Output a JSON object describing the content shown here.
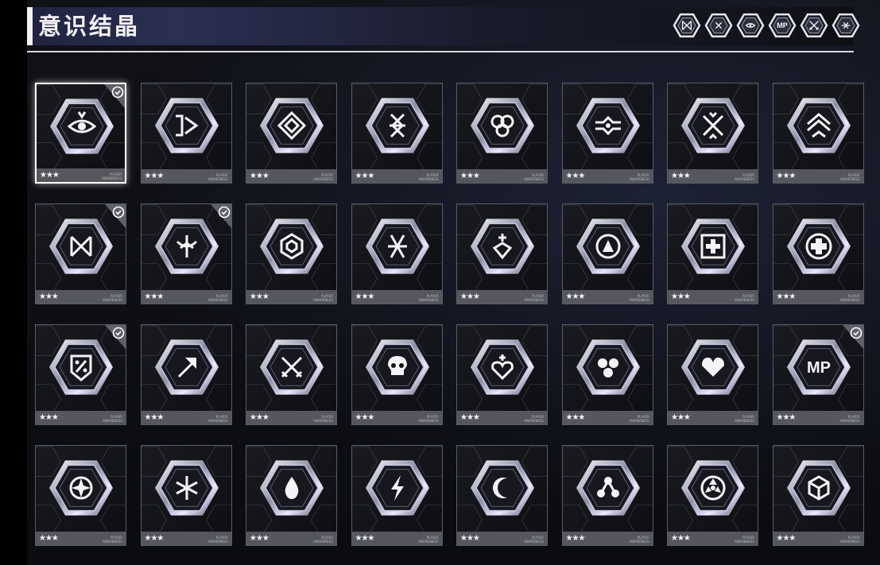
{
  "title": "意识结晶",
  "colors": {
    "accent": "#2b2f52",
    "card_border": "#5a5c66",
    "foot": "#55565e",
    "check_bg": "#5f606a"
  },
  "filters": [
    {
      "icon": "crossed-arrows-icon",
      "label": ""
    },
    {
      "icon": "x-diamond-icon",
      "label": ""
    },
    {
      "icon": "eye-diamond-icon",
      "label": ""
    },
    {
      "icon": "mp-icon",
      "label": "MP"
    },
    {
      "icon": "crossed-swords-icon",
      "label": ""
    },
    {
      "icon": "wing-icon",
      "label": ""
    }
  ],
  "cards": [
    {
      "icon": "eye-target-icon",
      "stars": "★★★",
      "caption1": "PLAYER",
      "caption2": "AWARENESS",
      "equipped": true,
      "selected": true
    },
    {
      "icon": "bracket-arrow-icon",
      "stars": "★★★",
      "caption1": "PLAYER",
      "caption2": "AWARENESS",
      "equipped": false,
      "selected": false
    },
    {
      "icon": "diamond-knot-icon",
      "stars": "★★★",
      "caption1": "PLAYER",
      "caption2": "AWARENESS",
      "equipped": false,
      "selected": false
    },
    {
      "icon": "chevron-lattice-icon",
      "stars": "★★★",
      "caption1": "PLAYER",
      "caption2": "AWARENESS",
      "equipped": false,
      "selected": false
    },
    {
      "icon": "triple-hex-icon",
      "stars": "★★★",
      "caption1": "PLAYER",
      "caption2": "AWARENESS",
      "equipped": false,
      "selected": false
    },
    {
      "icon": "circuit-eye-icon",
      "stars": "★★★",
      "caption1": "PLAYER",
      "caption2": "AWARENESS",
      "equipped": false,
      "selected": false
    },
    {
      "icon": "x-chevrons-icon",
      "stars": "★★★",
      "caption1": "PLAYER",
      "caption2": "AWARENESS",
      "equipped": false,
      "selected": false
    },
    {
      "icon": "layered-chevron-icon",
      "stars": "★★★",
      "caption1": "PLAYER",
      "caption2": "AWARENESS",
      "equipped": false,
      "selected": false
    },
    {
      "icon": "crossed-arrows-icon",
      "stars": "★★★",
      "caption1": "PLAYER",
      "caption2": "AWARENESS",
      "equipped": true,
      "selected": false
    },
    {
      "icon": "tree-sigil-icon",
      "stars": "★★★",
      "caption1": "PLAYER",
      "caption2": "AWARENESS",
      "equipped": true,
      "selected": false
    },
    {
      "icon": "hex-shield-icon",
      "stars": "★★★",
      "caption1": "PLAYER",
      "caption2": "AWARENESS",
      "equipped": false,
      "selected": false
    },
    {
      "icon": "star-cross-icon",
      "stars": "★★★",
      "caption1": "PLAYER",
      "caption2": "AWARENESS",
      "equipped": false,
      "selected": false
    },
    {
      "icon": "plus-gem-icon",
      "stars": "★★★",
      "caption1": "PLAYER",
      "caption2": "AWARENESS",
      "equipped": false,
      "selected": false
    },
    {
      "icon": "circle-a-icon",
      "stars": "★★★",
      "caption1": "PLAYER",
      "caption2": "AWARENESS",
      "equipped": false,
      "selected": false
    },
    {
      "icon": "medical-box-icon",
      "stars": "★★★",
      "caption1": "PLAYER",
      "caption2": "AWARENESS",
      "equipped": false,
      "selected": false
    },
    {
      "icon": "medical-cross-icon",
      "stars": "★★★",
      "caption1": "PLAYER",
      "caption2": "AWARENESS",
      "equipped": false,
      "selected": false
    },
    {
      "icon": "percent-shield-icon",
      "stars": "★★★",
      "caption1": "PLAYER",
      "caption2": "AWARENESS",
      "equipped": true,
      "selected": false
    },
    {
      "icon": "arrow-up-right-icon",
      "stars": "★★★",
      "caption1": "PLAYER",
      "caption2": "AWARENESS",
      "equipped": false,
      "selected": false
    },
    {
      "icon": "crossed-swords-icon",
      "stars": "★★★",
      "caption1": "PLAYER",
      "caption2": "AWARENESS",
      "equipped": false,
      "selected": false
    },
    {
      "icon": "skull-icon",
      "stars": "★★★",
      "caption1": "PLAYER",
      "caption2": "AWARENESS",
      "equipped": false,
      "selected": false
    },
    {
      "icon": "heart-plus-icon",
      "stars": "★★★",
      "caption1": "PLAYER",
      "caption2": "AWARENESS",
      "equipped": false,
      "selected": false
    },
    {
      "icon": "cluster-icon",
      "stars": "★★★",
      "caption1": "PLAYER",
      "caption2": "AWARENESS",
      "equipped": false,
      "selected": false
    },
    {
      "icon": "heart-icon",
      "stars": "★★★",
      "caption1": "PLAYER",
      "caption2": "AWARENESS",
      "equipped": false,
      "selected": false
    },
    {
      "icon": "mp-icon",
      "stars": "★★★",
      "caption1": "PLAYER",
      "caption2": "AWARENESS",
      "equipped": true,
      "selected": false,
      "text": "MP"
    },
    {
      "icon": "compass-star-icon",
      "stars": "★★★",
      "caption1": "PLAYER",
      "caption2": "AWARENESS",
      "equipped": false,
      "selected": false
    },
    {
      "icon": "snowflake-icon",
      "stars": "★★★",
      "caption1": "PLAYER",
      "caption2": "AWARENESS",
      "equipped": false,
      "selected": false
    },
    {
      "icon": "flame-icon",
      "stars": "★★★",
      "caption1": "PLAYER",
      "caption2": "AWARENESS",
      "equipped": false,
      "selected": false
    },
    {
      "icon": "lightning-icon",
      "stars": "★★★",
      "caption1": "PLAYER",
      "caption2": "AWARENESS",
      "equipped": false,
      "selected": false
    },
    {
      "icon": "crescent-icon",
      "stars": "★★★",
      "caption1": "PLAYER",
      "caption2": "AWARENESS",
      "equipped": false,
      "selected": false
    },
    {
      "icon": "tri-node-icon",
      "stars": "★★★",
      "caption1": "PLAYER",
      "caption2": "AWARENESS",
      "equipped": false,
      "selected": false
    },
    {
      "icon": "radiation-icon",
      "stars": "★★★",
      "caption1": "PLAYER",
      "caption2": "AWARENESS",
      "equipped": false,
      "selected": false
    },
    {
      "icon": "cube-icon",
      "stars": "★★★",
      "caption1": "PLAYER",
      "caption2": "AWARENESS",
      "equipped": false,
      "selected": false
    }
  ]
}
